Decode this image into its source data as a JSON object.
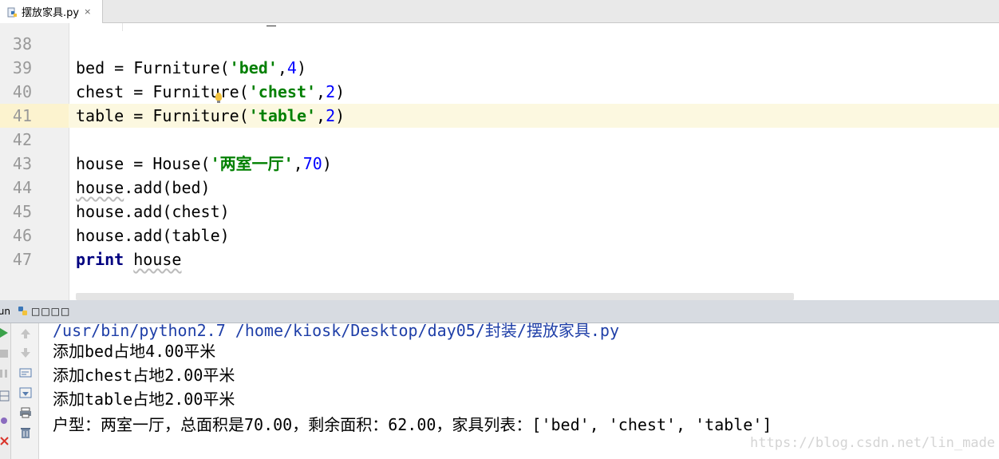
{
  "tab": {
    "filename": "摆放家具.py",
    "close_glyph": "×"
  },
  "editor": {
    "line_numbers": [
      "38",
      "39",
      "40",
      "41",
      "42",
      "43",
      "44",
      "45",
      "46",
      "47"
    ],
    "code": {
      "l39": {
        "var": "bed = Furniture(",
        "str": "'bed'",
        "comma": ",",
        "num": "4",
        "end": ")"
      },
      "l40": {
        "var": "chest = Furniture(",
        "str": "'chest'",
        "comma": ",",
        "num": "2",
        "end": ")"
      },
      "l41": {
        "var": "table = Furniture(",
        "str": "'table'",
        "comma": ",",
        "num": "2",
        "end": ")"
      },
      "l43": {
        "var": "house = House(",
        "str": "'两室一厅'",
        "comma": ",",
        "num": "70",
        "end": ")"
      },
      "l44": {
        "obj": "house",
        "rest": ".add(bed)"
      },
      "l45": {
        "text": "house.add(chest)"
      },
      "l46": {
        "text": "house.add(table)"
      },
      "l47": {
        "kw": "print",
        "arg": "house"
      }
    }
  },
  "run": {
    "label": "Run",
    "config_name": "□□□□",
    "console": [
      "/usr/bin/python2.7 /home/kiosk/Desktop/day05/封装/摆放家具.py",
      "添加bed占地4.00平米",
      "添加chest占地2.00平米",
      "添加table占地2.00平米",
      "户型：两室一厅，总面积是70.00，剩余面积：62.00，家具列表：['bed', 'chest', 'table']"
    ],
    "watermark": "https://blog.csdn.net/lin_made"
  },
  "colors": {
    "keyword": "#000080",
    "string": "#008000",
    "number": "#0000ff",
    "current_line": "#fcf8e0",
    "console_path": "#1f3fa8"
  }
}
